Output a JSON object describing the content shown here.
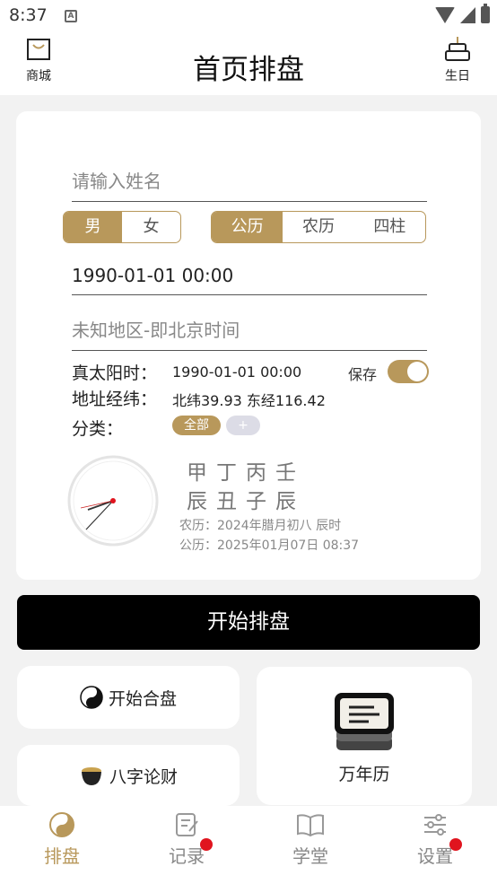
{
  "status_bar": {
    "time": "8:37",
    "notif_icon": "A"
  },
  "header": {
    "title": "首页排盘",
    "left_label": "商城",
    "right_label": "生日"
  },
  "form": {
    "name_placeholder": "请输入姓名",
    "gender": {
      "options": [
        "男",
        "女"
      ],
      "selected": "男"
    },
    "calendar": {
      "options": [
        "公历",
        "农历",
        "四柱"
      ],
      "selected": "公历"
    },
    "datetime_value": "1990-01-01 00:00",
    "region_placeholder": "未知地区-即北京时间",
    "solar_time_label": "真太阳时：",
    "solar_time_value": "1990-01-01 00:00",
    "save_label": "保存",
    "save_enabled": true,
    "coords_label": "地址经纬：",
    "coords_value": "北纬39.93 东经116.42",
    "category_label": "分类：",
    "category_all": "全部",
    "category_add": "+"
  },
  "bazi": {
    "stems": "甲丁丙壬",
    "branches": "辰丑子辰",
    "lunar_line": "农历：2024年腊月初八 辰时",
    "solar_line": "公历：2025年01月07日 08:37"
  },
  "actions": {
    "start_button": "开始排盘",
    "hepan": "开始合盘",
    "bazi_caifu": "八字论财",
    "wannianli": "万年历"
  },
  "tabs": [
    {
      "label": "排盘",
      "active": true,
      "badge": false
    },
    {
      "label": "记录",
      "active": false,
      "badge": true
    },
    {
      "label": "学堂",
      "active": false,
      "badge": false
    },
    {
      "label": "设置",
      "active": false,
      "badge": true
    }
  ],
  "colors": {
    "accent": "#b8985b",
    "badge": "#e0141e"
  }
}
